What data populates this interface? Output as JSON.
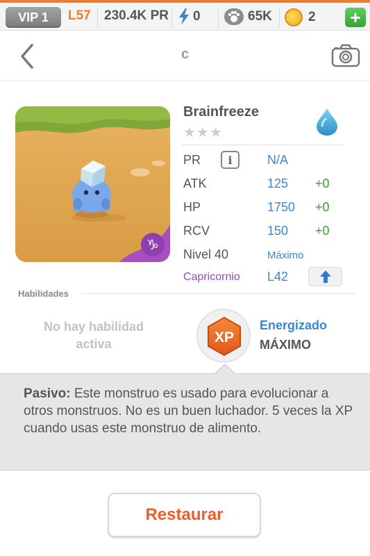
{
  "status_bar": {
    "vip": "VIP 1",
    "level": "L57",
    "power": "230.4K",
    "power_unit": "PR",
    "energy": "0",
    "food": "65K",
    "coins": "2",
    "add_label": "+"
  },
  "header": {
    "title": "c"
  },
  "monster": {
    "name": "Brainfreeze",
    "stars": "★★★",
    "element_icon": "water-drop-icon",
    "zodiac_badge": "capricorn-icon",
    "stats": {
      "pr_label": "PR",
      "pr_value": "N/A",
      "atk_label": "ATK",
      "atk_value": "125",
      "atk_bonus": "+0",
      "hp_label": "HP",
      "hp_value": "1750",
      "hp_bonus": "+0",
      "rcv_label": "RCV",
      "rcv_value": "150",
      "rcv_bonus": "+0",
      "level_label": "Nivel 40",
      "level_value": "Máximo",
      "zodiac_label": "Capricornio",
      "zodiac_value": "L42"
    }
  },
  "abilities": {
    "section_label": "Habilidades",
    "active": "No hay habilidad activa",
    "badge_text": "XP",
    "passive_title": "Energizado",
    "passive_level": "MÁXIMO"
  },
  "passive": {
    "label": "Pasivo:",
    "text": " Este monstruo es usado para evolucionar a otros monstruos. No es un buen luchador. 5 veces la XP cuando usas este monstruo de alimento."
  },
  "actions": {
    "restore": "Restaurar"
  },
  "colors": {
    "accent_orange": "#f07d2a",
    "stat_blue": "#3a87d0",
    "bonus_green": "#36a32c",
    "zodiac_purple": "#8a4fc0",
    "restore_red": "#ef5d2d"
  }
}
